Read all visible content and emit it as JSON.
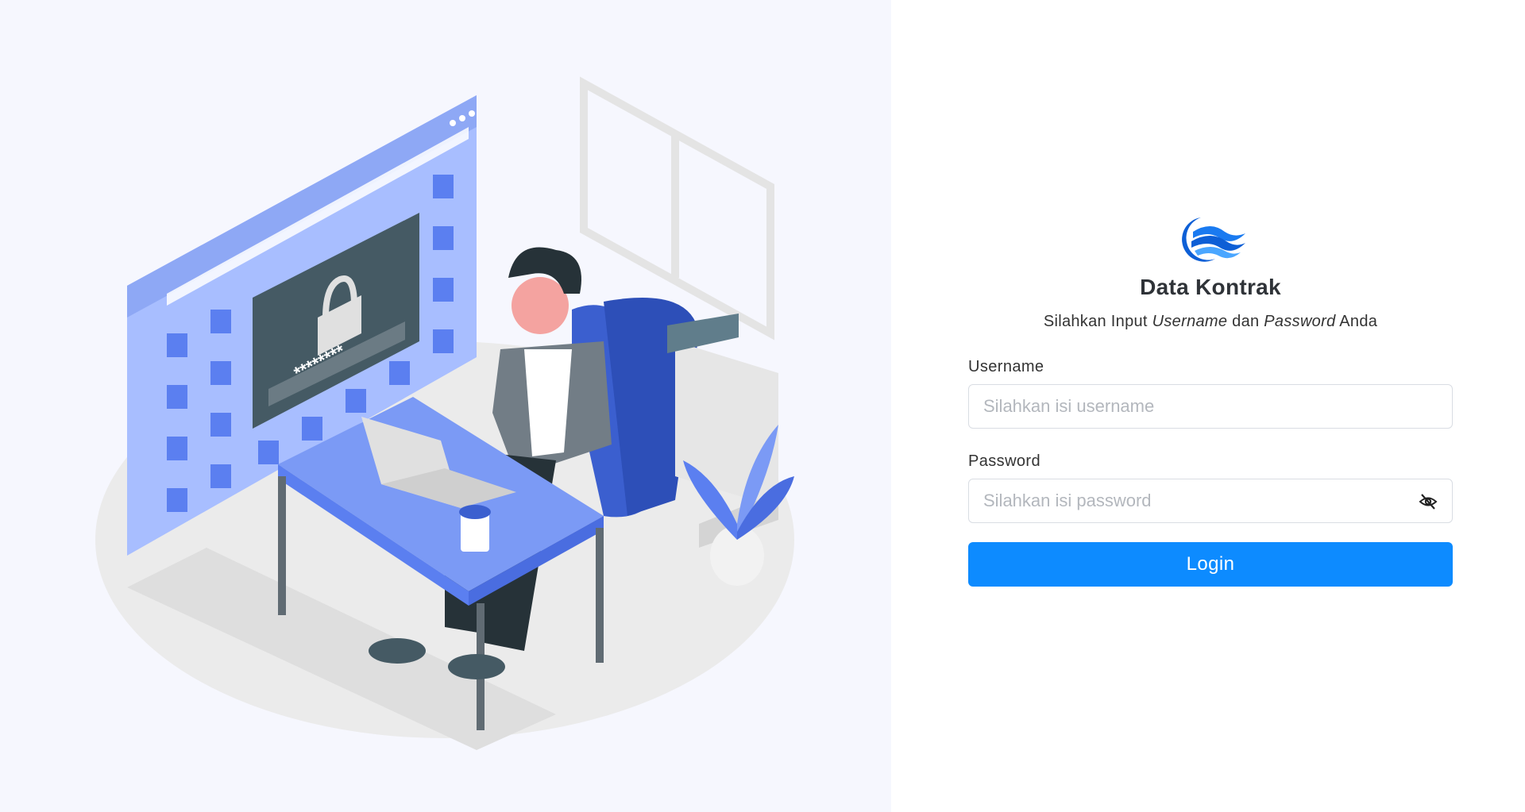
{
  "colors": {
    "left_background": "#f6f7fe",
    "accent": "#0d8bff",
    "illustration_blue": "#5b7ff0",
    "illustration_light_blue": "#a8beff"
  },
  "illustration": {
    "lock_screen_text": "********",
    "icon": "person-at-desk-login-security-illustration"
  },
  "login": {
    "logo_icon": "wave-logo-icon",
    "title": "Data Kontrak",
    "subtitle_prefix": "Silahkan Input ",
    "subtitle_em1": "Username",
    "subtitle_mid": " dan ",
    "subtitle_em2": "Password",
    "subtitle_suffix": " Anda",
    "username_label": "Username",
    "username_placeholder": "Silahkan isi username",
    "username_value": "",
    "password_label": "Password",
    "password_placeholder": "Silahkan isi password",
    "password_value": "",
    "password_toggle_icon": "eye-slash-icon",
    "login_button": "Login"
  }
}
